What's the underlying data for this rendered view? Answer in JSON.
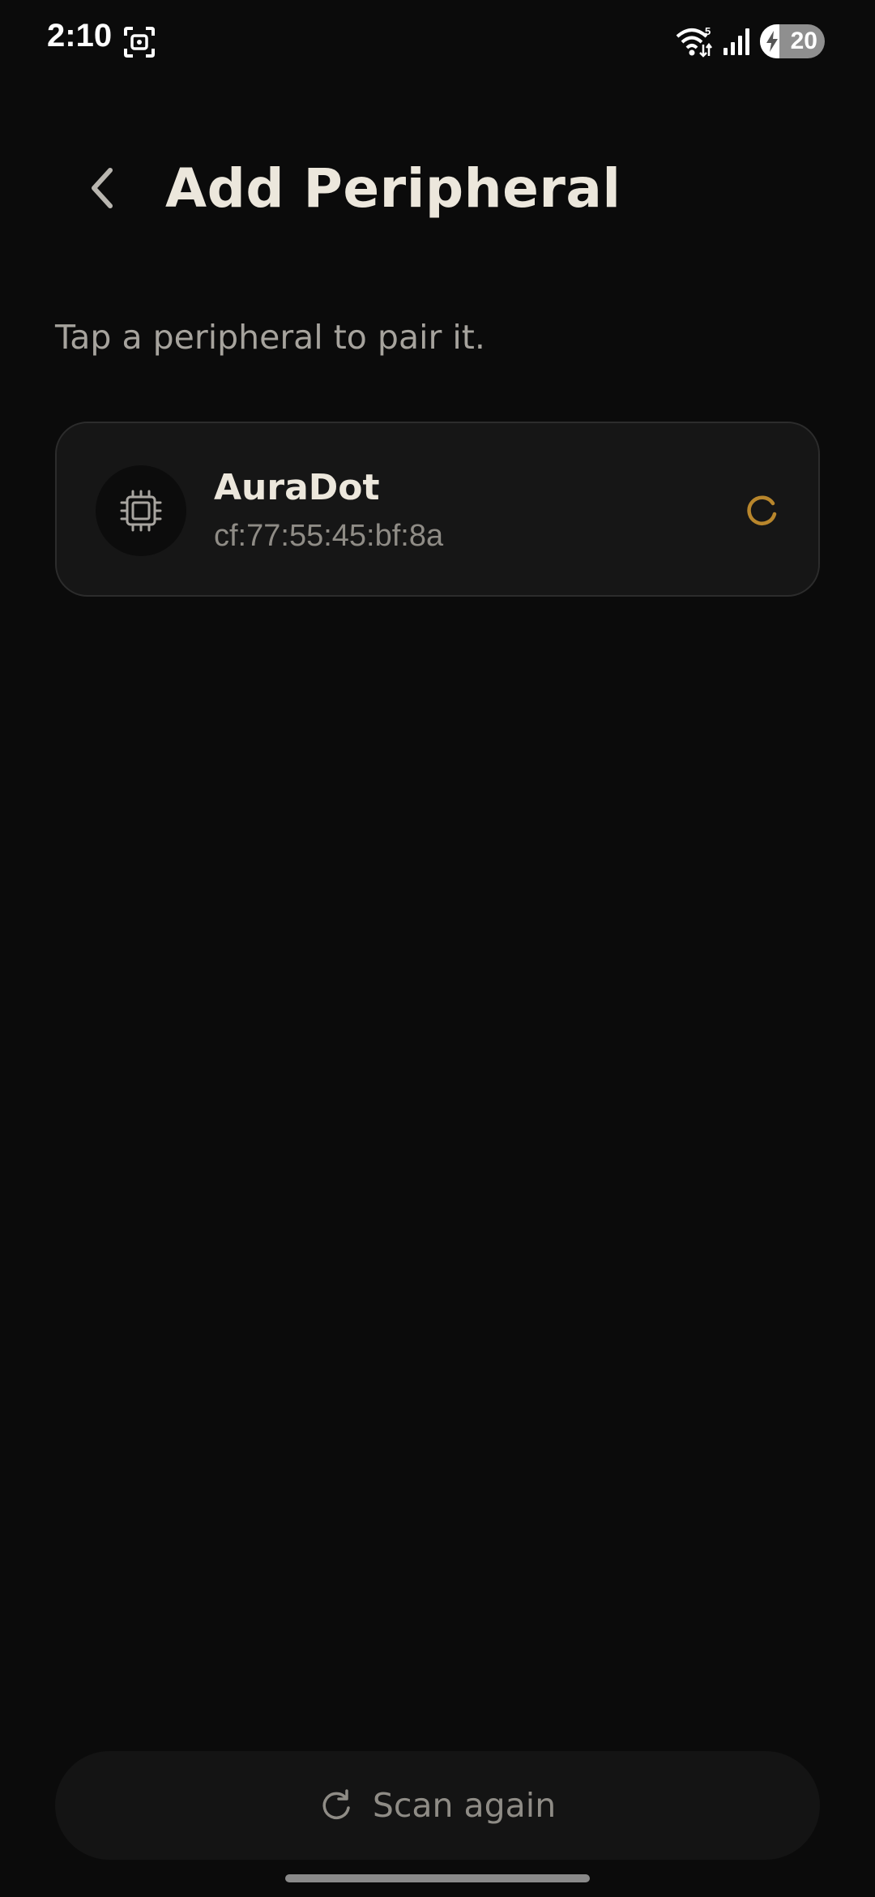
{
  "status_bar": {
    "time": "2:10",
    "battery_level": "20",
    "icons": [
      "screenshot-icon",
      "wifi-icon",
      "signal-icon",
      "battery-icon"
    ]
  },
  "header": {
    "title": "Add Peripheral",
    "back_icon": "chevron-left-icon"
  },
  "instruction": "Tap a peripheral to pair it.",
  "devices": [
    {
      "name": "AuraDot",
      "address": "cf:77:55:45:bf:8a",
      "icon": "chip-icon",
      "status": "pairing",
      "status_icon": "spinner-icon"
    }
  ],
  "scan_button": {
    "label": "Scan again",
    "icon": "refresh-icon"
  },
  "colors": {
    "background": "#0b0b0b",
    "card_background": "#161616",
    "card_border": "#2c2c2c",
    "title_text": "#ece7dc",
    "secondary_text": "#a6a39d",
    "accent_spinner": "#b8862c"
  }
}
